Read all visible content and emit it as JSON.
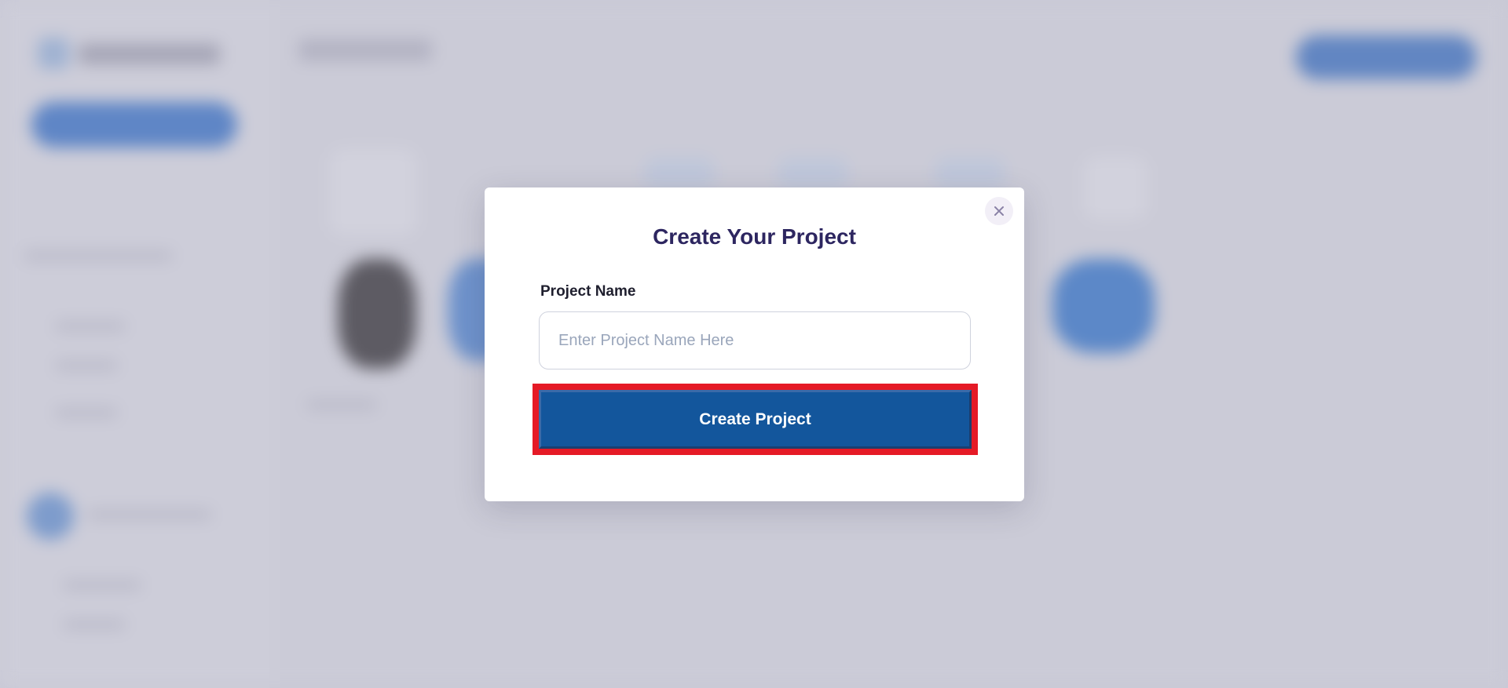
{
  "modal": {
    "title": "Create Your Project",
    "field_label": "Project Name",
    "input_value": "",
    "input_placeholder": "Enter Project Name Here",
    "submit_label": "Create Project",
    "close_icon": "close-icon"
  },
  "colors": {
    "title": "#2d2660",
    "primary_button": "#13569c",
    "highlight": "#e51a26",
    "backdrop": "#c9c9d6"
  }
}
